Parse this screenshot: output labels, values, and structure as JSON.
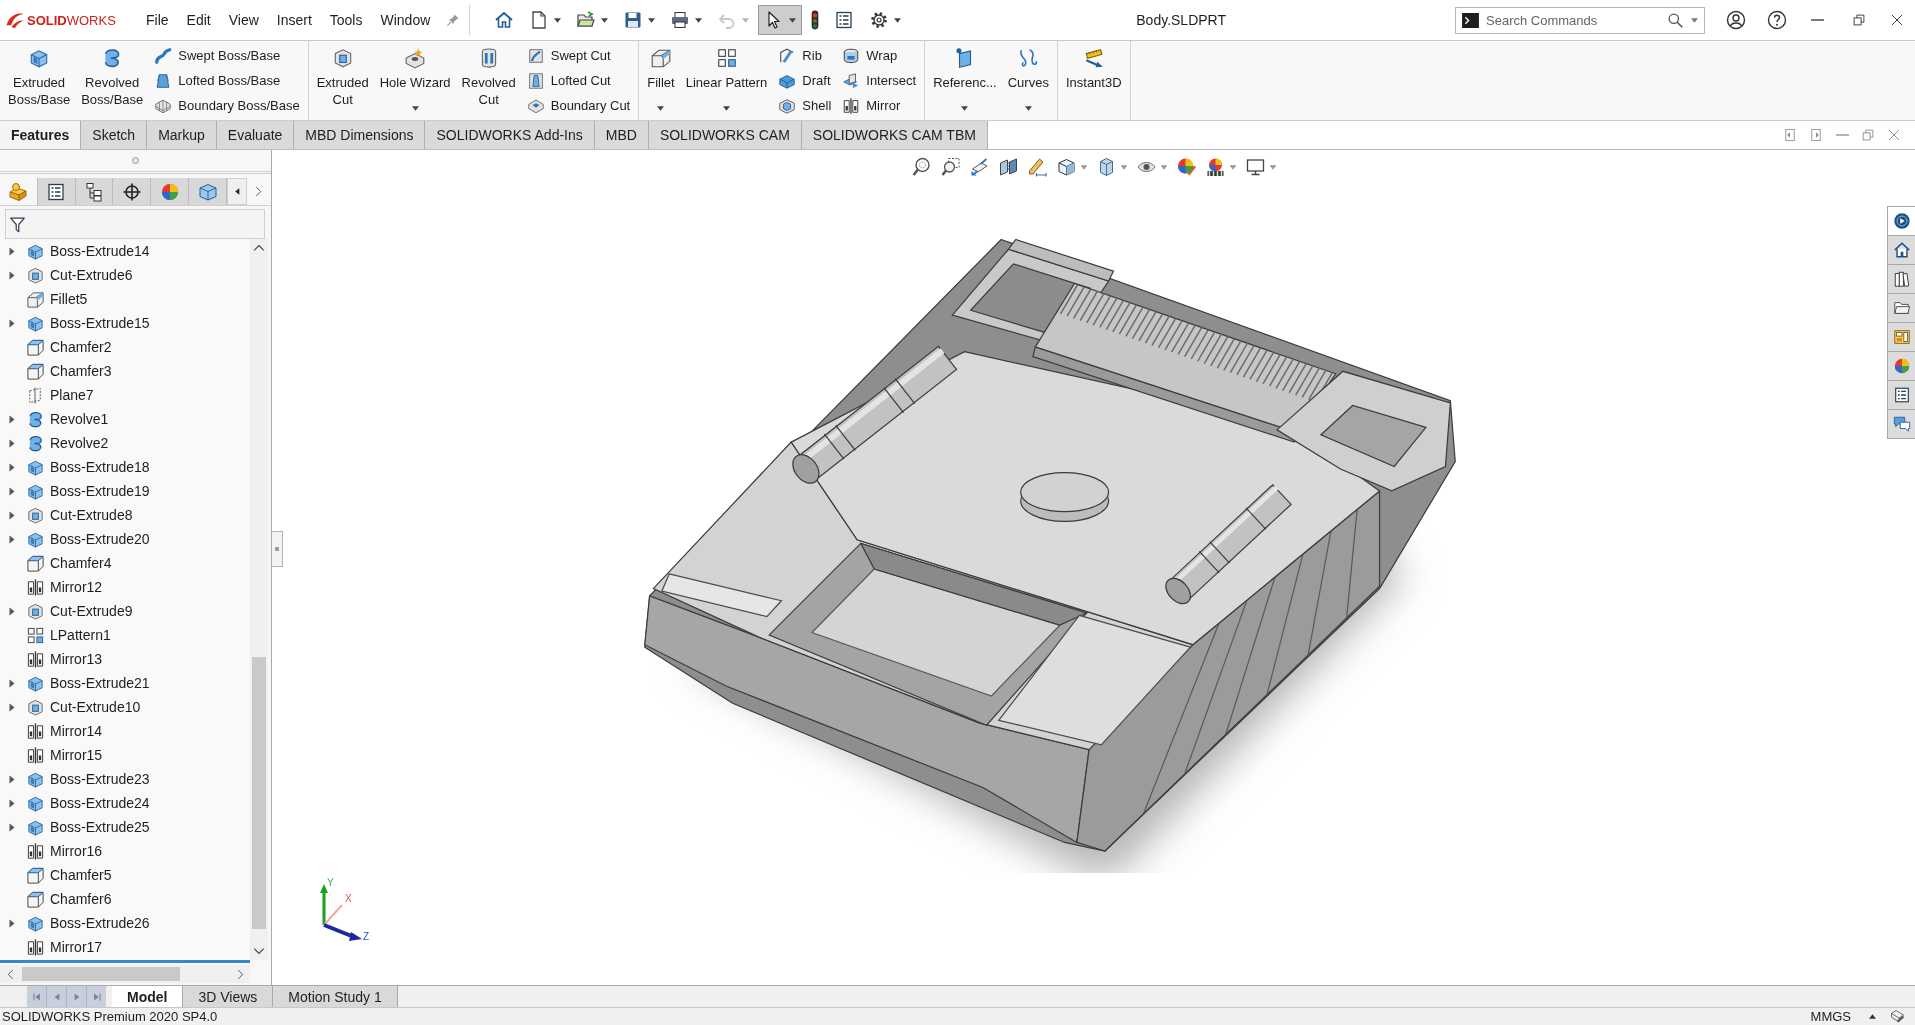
{
  "app": {
    "logo": "**SOLID**WORKS",
    "menu": [
      "File",
      "Edit",
      "View",
      "Insert",
      "Tools",
      "Window"
    ],
    "quick_access": [
      {
        "dropdown": false,
        "pressed": false,
        "disabled": false
      },
      {
        "dropdown": true,
        "pressed": false,
        "disabled": false
      },
      {
        "dropdown": true,
        "pressed": false,
        "disabled": false
      },
      {
        "dropdown": true,
        "pressed": false,
        "disabled": false
      },
      {
        "dropdown": true,
        "pressed": false,
        "disabled": false
      },
      {
        "dropdown": true,
        "pressed": false,
        "disabled": true
      },
      {
        "dropdown": true,
        "pressed": true,
        "disabled": false
      },
      {
        "dropdown": false,
        "pressed": false,
        "disabled": false
      },
      {
        "dropdown": false,
        "pressed": false,
        "disabled": false
      },
      {
        "dropdown": true,
        "pressed": false,
        "disabled": false
      }
    ],
    "title": "Body.SLDPRT",
    "search": {
      "placeholder": "Search Commands"
    }
  },
  "ribbon": [
    {
      "items": [
        {
          "kind": "large",
          "label": "Extruded Boss/Base"
        },
        {
          "kind": "large",
          "label": "Revolved Boss/Base"
        },
        {
          "kind": "stack",
          "buttons": [
            "Swept Boss/Base",
            "Lofted Boss/Base",
            "Boundary Boss/Base"
          ]
        }
      ]
    },
    {
      "items": [
        {
          "kind": "large",
          "label": "Extruded Cut"
        },
        {
          "kind": "dropdown",
          "label": "Hole Wizard"
        },
        {
          "kind": "large",
          "label": "Revolved Cut"
        },
        {
          "kind": "stack",
          "buttons": [
            "Swept Cut",
            "Lofted Cut",
            "Boundary Cut"
          ]
        }
      ]
    },
    {
      "items": [
        {
          "kind": "dropdown",
          "label": "Fillet"
        },
        {
          "kind": "dropdown",
          "label": "Linear Pattern"
        },
        {
          "kind": "stack",
          "buttons": [
            "Rib",
            "Draft",
            "Shell"
          ]
        },
        {
          "kind": "stack",
          "buttons": [
            "Wrap",
            "Intersect",
            "Mirror"
          ]
        }
      ]
    },
    {
      "items": [
        {
          "kind": "dropdown",
          "label": "Referenc..."
        },
        {
          "kind": "dropdown",
          "label": "Curves"
        }
      ]
    },
    {
      "items": [
        {
          "kind": "large",
          "label": "Instant3D"
        }
      ]
    }
  ],
  "command_tabs": [
    {
      "label": "Features",
      "selected": true
    },
    {
      "label": "Sketch",
      "selected": false
    },
    {
      "label": "Markup",
      "selected": false
    },
    {
      "label": "Evaluate",
      "selected": false
    },
    {
      "label": "MBD Dimensions",
      "selected": false
    },
    {
      "label": "SOLIDWORKS Add-Ins",
      "selected": false
    },
    {
      "label": "MBD",
      "selected": false
    },
    {
      "label": "SOLIDWORKS CAM",
      "selected": false
    },
    {
      "label": "SOLIDWORKS CAM TBM",
      "selected": false
    }
  ],
  "feature_tree": {
    "panel_tabs": [
      {
        "selected": true
      },
      {
        "selected": false
      },
      {
        "selected": false
      },
      {
        "selected": false
      },
      {
        "selected": false
      },
      {
        "selected": false
      }
    ],
    "items": [
      {
        "label": "Boss-Extrude14",
        "kind": "boss",
        "has_children": true,
        "expanded": false
      },
      {
        "label": "Cut-Extrude6",
        "kind": "cut",
        "has_children": true,
        "expanded": false
      },
      {
        "label": "Fillet5",
        "kind": "fillet",
        "has_children": false,
        "expanded": false
      },
      {
        "label": "Boss-Extrude15",
        "kind": "boss",
        "has_children": true,
        "expanded": false
      },
      {
        "label": "Chamfer2",
        "kind": "chamfer",
        "has_children": false,
        "expanded": false
      },
      {
        "label": "Chamfer3",
        "kind": "chamfer",
        "has_children": false,
        "expanded": false
      },
      {
        "label": "Plane7",
        "kind": "plane",
        "has_children": false,
        "expanded": false
      },
      {
        "label": "Revolve1",
        "kind": "revolve",
        "has_children": true,
        "expanded": false
      },
      {
        "label": "Revolve2",
        "kind": "revolve",
        "has_children": true,
        "expanded": false
      },
      {
        "label": "Boss-Extrude18",
        "kind": "boss",
        "has_children": true,
        "expanded": false
      },
      {
        "label": "Boss-Extrude19",
        "kind": "boss",
        "has_children": true,
        "expanded": false
      },
      {
        "label": "Cut-Extrude8",
        "kind": "cut",
        "has_children": true,
        "expanded": false
      },
      {
        "label": "Boss-Extrude20",
        "kind": "boss",
        "has_children": true,
        "expanded": false
      },
      {
        "label": "Chamfer4",
        "kind": "chamfer",
        "has_children": false,
        "expanded": false
      },
      {
        "label": "Mirror12",
        "kind": "mirror",
        "has_children": false,
        "expanded": false
      },
      {
        "label": "Cut-Extrude9",
        "kind": "cut",
        "has_children": true,
        "expanded": false
      },
      {
        "label": "LPattern1",
        "kind": "pattern",
        "has_children": false,
        "expanded": false
      },
      {
        "label": "Mirror13",
        "kind": "mirror",
        "has_children": false,
        "expanded": false
      },
      {
        "label": "Boss-Extrude21",
        "kind": "boss",
        "has_children": true,
        "expanded": false
      },
      {
        "label": "Cut-Extrude10",
        "kind": "cut",
        "has_children": true,
        "expanded": false
      },
      {
        "label": "Mirror14",
        "kind": "mirror",
        "has_children": false,
        "expanded": false
      },
      {
        "label": "Mirror15",
        "kind": "mirror",
        "has_children": false,
        "expanded": false
      },
      {
        "label": "Boss-Extrude23",
        "kind": "boss",
        "has_children": true,
        "expanded": false
      },
      {
        "label": "Boss-Extrude24",
        "kind": "boss",
        "has_children": true,
        "expanded": false
      },
      {
        "label": "Boss-Extrude25",
        "kind": "boss",
        "has_children": true,
        "expanded": false
      },
      {
        "label": "Mirror16",
        "kind": "mirror",
        "has_children": false,
        "expanded": false
      },
      {
        "label": "Chamfer5",
        "kind": "chamfer",
        "has_children": false,
        "expanded": false
      },
      {
        "label": "Chamfer6",
        "kind": "chamfer",
        "has_children": false,
        "expanded": false
      },
      {
        "label": "Boss-Extrude26",
        "kind": "boss",
        "has_children": true,
        "expanded": false
      },
      {
        "label": "Mirror17",
        "kind": "mirror",
        "has_children": false,
        "expanded": false
      }
    ]
  },
  "graphics": {
    "triad_labels": [
      "Y",
      "X",
      "Z"
    ]
  },
  "task_pane": [
    {
      "selected": true
    },
    {
      "selected": false
    },
    {
      "selected": false
    },
    {
      "selected": false
    },
    {
      "selected": false
    },
    {
      "selected": false
    },
    {
      "selected": false
    },
    {
      "selected": false
    }
  ],
  "bottom_tabs": [
    {
      "label": "Model",
      "selected": true
    },
    {
      "label": "3D Views",
      "selected": false
    },
    {
      "label": "Motion Study 1",
      "selected": false
    }
  ],
  "status_bar": {
    "product": "SOLIDWORKS Premium 2020 SP4.0",
    "units": "MMGS"
  }
}
